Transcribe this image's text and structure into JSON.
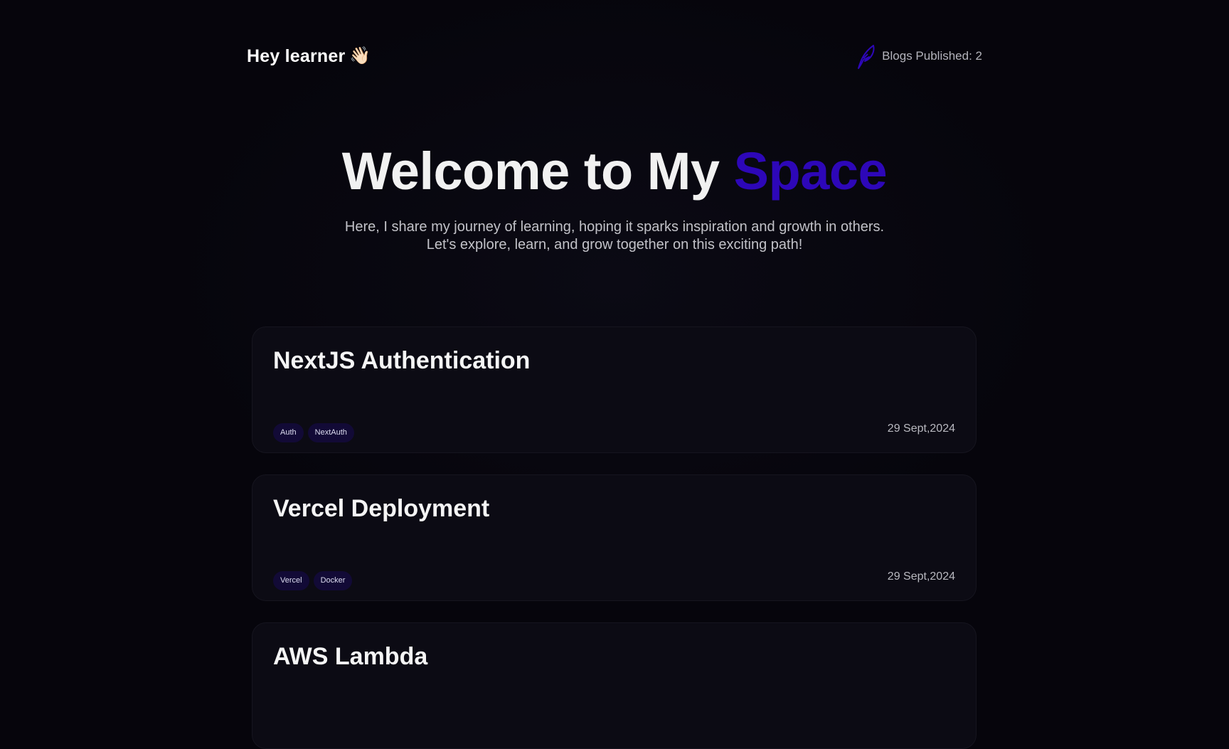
{
  "header": {
    "greeting": "Hey learner",
    "wave_emoji": "👋🏻",
    "blogs_published": "Blogs Published: 2",
    "feather_icon": "feather-icon",
    "accent_color": "#2d07b8"
  },
  "hero": {
    "title_main": "Welcome to My ",
    "title_accent": "Space",
    "subtitle": "Here, I share my journey of learning, hoping it sparks inspiration and growth in others. Let's explore, learn, and grow together on this exciting path!"
  },
  "posts": [
    {
      "title": "NextJS Authentication",
      "tags": [
        "Auth",
        "NextAuth"
      ],
      "date": "29 Sept,2024"
    },
    {
      "title": "Vercel Deployment",
      "tags": [
        "Vercel",
        "Docker"
      ],
      "date": "29 Sept,2024"
    },
    {
      "title": "AWS Lambda",
      "tags": [],
      "date": ""
    }
  ]
}
